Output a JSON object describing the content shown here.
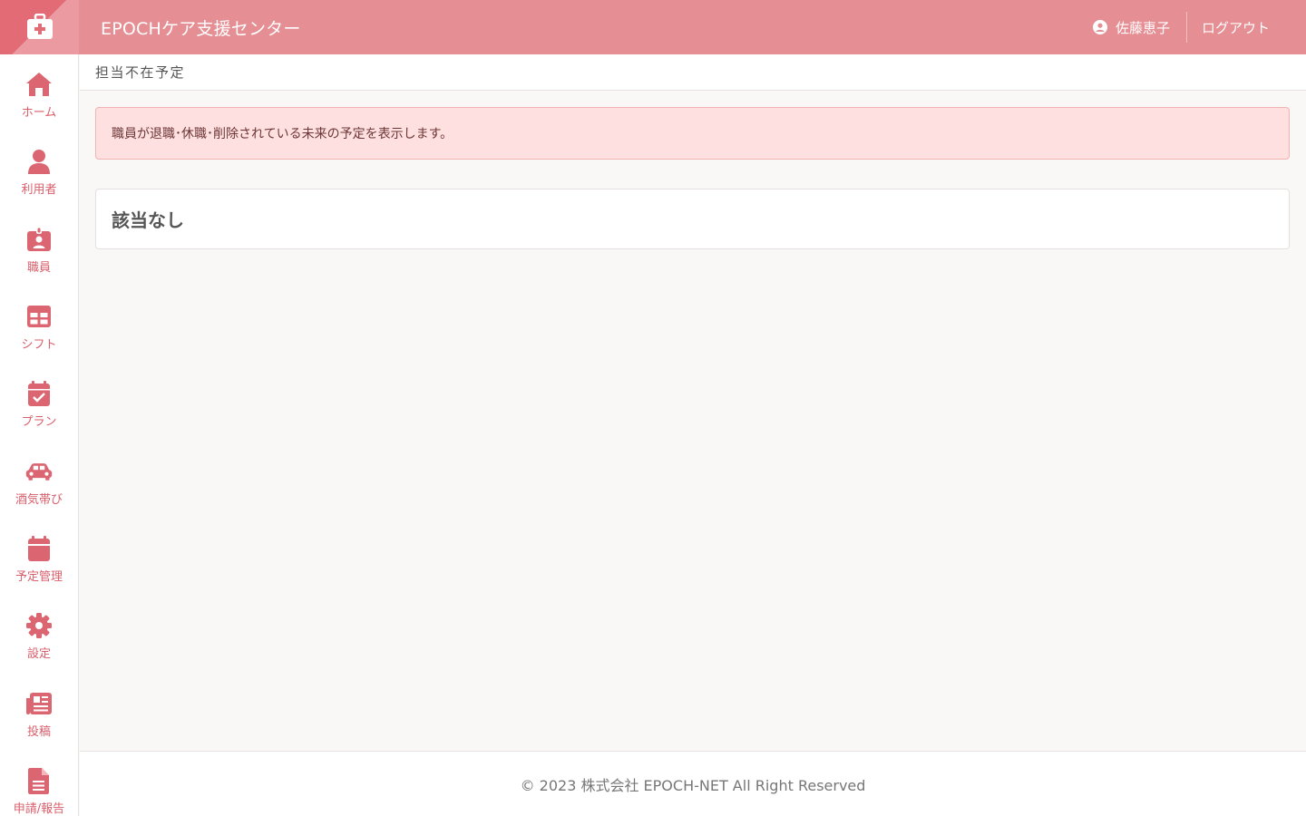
{
  "header": {
    "app_title": "EPOCHケア支援センター",
    "user_name": "佐藤恵子",
    "logout_label": "ログアウト"
  },
  "sidebar": {
    "items": [
      {
        "label": "ホーム",
        "icon": "home-icon"
      },
      {
        "label": "利用者",
        "icon": "user-icon"
      },
      {
        "label": "職員",
        "icon": "id-badge-icon"
      },
      {
        "label": "シフト",
        "icon": "table-icon"
      },
      {
        "label": "プラン",
        "icon": "calendar-check-icon"
      },
      {
        "label": "酒気帯び",
        "icon": "car-icon"
      },
      {
        "label": "予定管理",
        "icon": "calendar-icon"
      },
      {
        "label": "設定",
        "icon": "gear-icon"
      },
      {
        "label": "投稿",
        "icon": "newspaper-icon"
      },
      {
        "label": "申請/報告",
        "icon": "file-icon"
      }
    ]
  },
  "page": {
    "title": "担当不在予定",
    "alert_text": "職員が退職･休職･削除されている未来の予定を表示します。",
    "empty_text": "該当なし"
  },
  "footer": {
    "copyright": "© 2023 株式会社 EPOCH-NET All Right Reserved"
  },
  "colors": {
    "header_bg": "#e58e93",
    "accent": "#dc6572",
    "alert_bg": "#fde0df"
  }
}
